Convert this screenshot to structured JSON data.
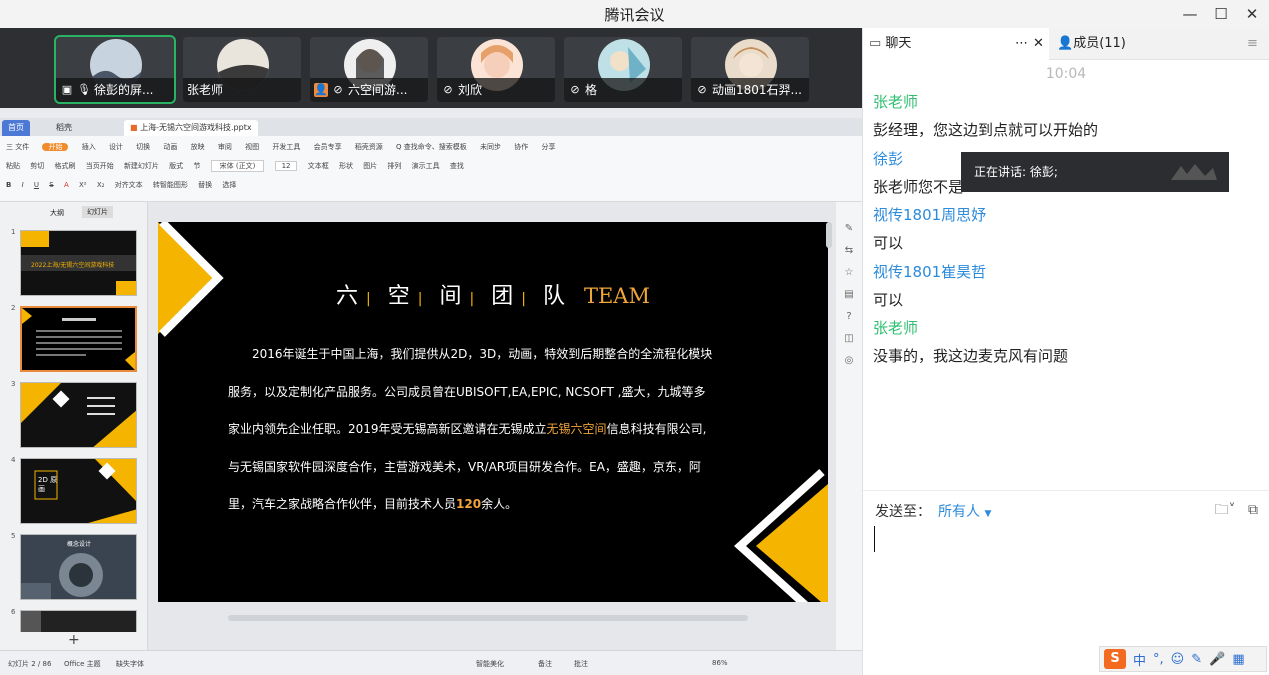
{
  "window": {
    "title": "腾讯会议",
    "controls": [
      "—",
      "☐",
      "✕"
    ]
  },
  "participants": [
    {
      "name": "徐彭的屏...",
      "icons": [
        "screen-share-icon",
        "mic-icon"
      ],
      "active": true
    },
    {
      "name": "张老师",
      "icons": []
    },
    {
      "name": "六空间游...",
      "icons": [
        "avatar-badge-icon",
        "mic-muted-icon"
      ]
    },
    {
      "name": "刘欣",
      "icons": [
        "mic-muted-icon"
      ]
    },
    {
      "name": "格",
      "icons": [
        "mic-muted-icon"
      ]
    },
    {
      "name": "动画1801石羿...",
      "icons": [
        "mic-muted-icon"
      ]
    }
  ],
  "shared_screen": {
    "tabs": {
      "home": "首页",
      "shell": "稻壳",
      "file": "上海-无锡六空间游戏科技.pptx"
    },
    "menu": [
      "三 文件",
      "开始",
      "插入",
      "设计",
      "切换",
      "动画",
      "放映",
      "审阅",
      "视图",
      "开发工具",
      "会员专享",
      "稻壳资源",
      "Q 查找命令、搜索模板",
      "未同步",
      "协作",
      "分享"
    ],
    "ribbon_row1": [
      "粘贴",
      "剪切",
      "格式刷",
      "当页开始",
      "新建幻灯片",
      "版式",
      "节",
      "宋体 (正文)",
      "12",
      "文本框",
      "形状",
      "图片",
      "排列",
      "演示工具",
      "查找"
    ],
    "ribbon_row2": [
      "B",
      "I",
      "U",
      "S",
      "A",
      "X²",
      "X₂",
      "对齐文本",
      "转智能图形",
      "替换",
      "选择"
    ],
    "panel_tabs": [
      "大纲",
      "幻灯片"
    ],
    "slide_numbers": [
      "1",
      "2",
      "3",
      "4",
      "5",
      "6"
    ],
    "thumb1_text": "2022上海/无锡六空间游戏科技",
    "thumb4_text": "2D 原画",
    "thumb5_text": "概念设计",
    "slide": {
      "title_chars": [
        "六",
        "空",
        "间",
        "团",
        "队"
      ],
      "title_team": "TEAM",
      "line1": "2016年诞生于中国上海，我们提供从2D，3D，动画，特效到后期整合的全流程化模块",
      "line2": "服务，以及定制化产品服务。公司成员曾在UBISOFT,EA,EPIC, NCSOFT ,盛大，九城等多",
      "line3_a": "家业内领先企业任职。2019年受无锡高新区邀请在无锡成立",
      "line3_hl": "无锡六空间",
      "line3_b": "信息科技有限公司,",
      "line4": "与无锡国家软件园深度合作，主营游戏美术，VR/AR项目研发合作。EA，盛趣，京东，阿",
      "line5_a": "里，汽车之家战略合作伙伴，目前技术人员",
      "line5_hl": "120",
      "line5_b": "余人。"
    },
    "status": {
      "slide_index": "幻灯片 2 / 86",
      "theme": "Office 主题",
      "font_missing": "缺失字体",
      "smart": "智能美化",
      "notes": "备注",
      "comment": "批注",
      "zoom": "86%"
    }
  },
  "chat": {
    "tab_chat": "聊天",
    "tab_members": "成员(11)",
    "time": "10:04",
    "messages": [
      {
        "sender": "张老师",
        "color": "green",
        "text": "彭经理，您这边到点就可以开始的"
      },
      {
        "sender": "徐彭",
        "color": "blue",
        "text": "张老师您不是"
      },
      {
        "sender": "视传1801周思妤",
        "color": "blue",
        "text": "可以"
      },
      {
        "sender": "视传1801崔昊哲",
        "color": "blue",
        "text": "可以"
      },
      {
        "sender": "张老师",
        "color": "green",
        "text": "没事的，我这边麦克风有问题"
      }
    ],
    "speaking": "正在讲话: 徐彭;",
    "send_to_label": "发送至：",
    "send_to_target": "所有人",
    "ime": {
      "logo": "S",
      "mode": "中",
      "punct": "°,"
    }
  },
  "colors": {
    "accent_green": "#28b463",
    "sender_green": "#2fbf71",
    "sender_blue": "#2c8bdb",
    "slide_yellow": "#f4b400",
    "slide_orange": "#f0a43a"
  }
}
